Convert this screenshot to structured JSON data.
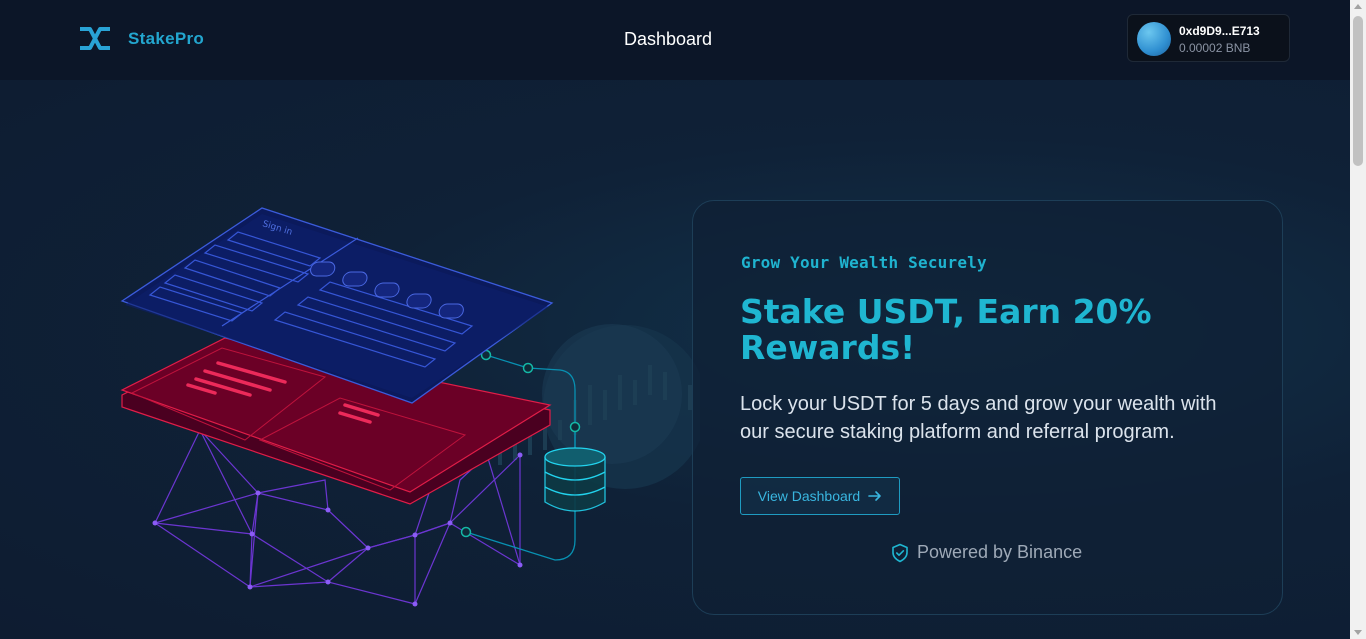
{
  "app": {
    "brand": "StakePro",
    "page_title": "Dashboard"
  },
  "wallet": {
    "address": "0xd9D9...E713",
    "balance": "0.00002 BNB"
  },
  "hero": {
    "eyebrow": "Grow Your Wealth Securely",
    "headline": "Stake USDT, Earn 20% Rewards!",
    "description": "Lock your USDT for 5 days and grow your wealth with our secure staking platform and referral program.",
    "cta_label": "View Dashboard",
    "cta_icon": "arrow-right-icon",
    "powered_by": "Powered by Binance",
    "powered_icon": "shield-check-icon"
  },
  "illustration": {
    "signin_label": "Sign in"
  },
  "colors": {
    "accent": "#1fb6d1",
    "nav_bg": "#0c1628",
    "page_bg": "#0f1e33",
    "card_border": "#1d3e57"
  }
}
